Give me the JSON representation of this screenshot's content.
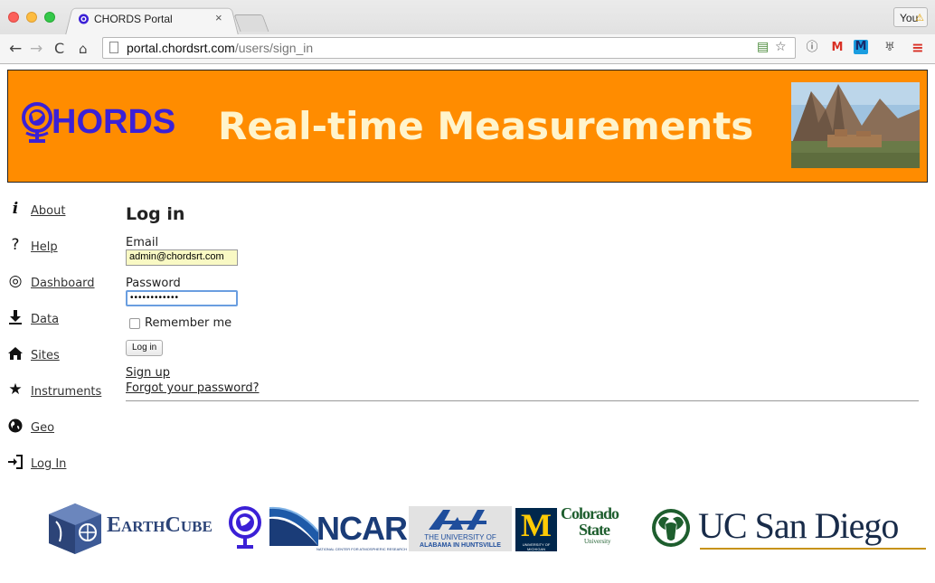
{
  "browser": {
    "tab_title": "CHORDS Portal",
    "tab_close": "×",
    "profile_label": "You",
    "url_host": "portal.chordsrt.com",
    "url_path": "/users/sign_in"
  },
  "banner": {
    "logo_text": "HORDS",
    "tagline": "Real-time Measurements"
  },
  "sidebar": {
    "items": [
      {
        "icon": "info-icon",
        "label": "About"
      },
      {
        "icon": "question-icon",
        "label": "Help"
      },
      {
        "icon": "target-icon",
        "label": "Dashboard"
      },
      {
        "icon": "download-icon",
        "label": "Data"
      },
      {
        "icon": "home-icon",
        "label": "Sites"
      },
      {
        "icon": "star-icon",
        "label": "Instruments"
      },
      {
        "icon": "globe-icon",
        "label": "Geo"
      },
      {
        "icon": "login-icon",
        "label": "Log In"
      }
    ]
  },
  "login": {
    "title": "Log in",
    "email_label": "Email",
    "email_value": "admin@chordsrt.com",
    "password_label": "Password",
    "password_value": "••••••••••••",
    "remember_label": "Remember me",
    "submit_label": "Log in",
    "signup_link": "Sign up",
    "forgot_link": "Forgot your password?"
  },
  "footer": {
    "earthcube": "EarthCube",
    "ncar": "NCAR",
    "ncar_sub": "NATIONAL CENTER FOR ATMOSPHERIC RESEARCH",
    "uah_line1": "THE UNIVERSITY OF",
    "uah_line2": "ALABAMA IN HUNTSVILLE",
    "umich": "UNIVERSITY OF MICHIGAN",
    "csu_line1": "Colorado",
    "csu_line2": "State",
    "csu_line3": "University",
    "ucsd": "UC San Diego"
  }
}
